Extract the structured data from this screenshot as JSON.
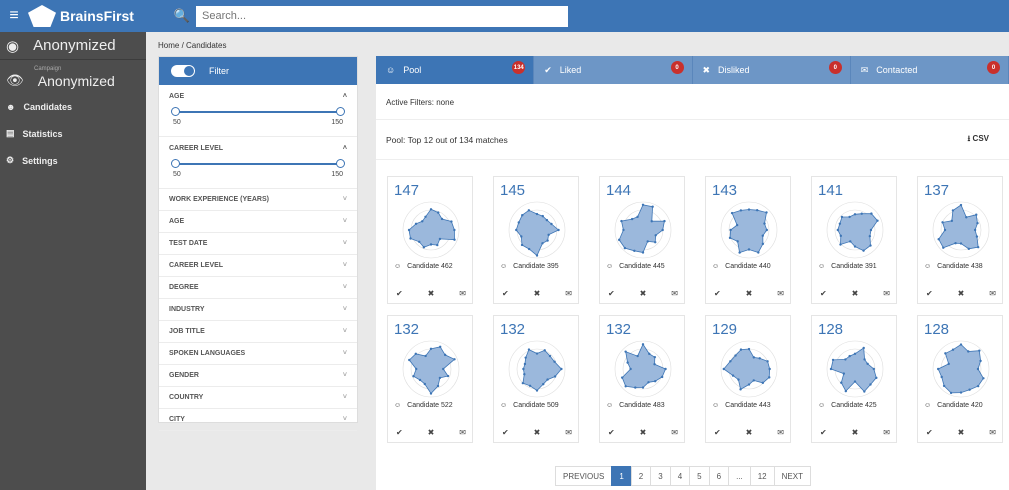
{
  "brand": "BrainsFirst",
  "search": {
    "placeholder": "Search..."
  },
  "sidebar": {
    "user": "Anonymized",
    "campaign_label": "Campaign",
    "campaign": "Anonymized",
    "items": [
      {
        "label": "Candidates",
        "icon": "users-icon"
      },
      {
        "label": "Statistics",
        "icon": "chart-icon"
      },
      {
        "label": "Settings",
        "icon": "gear-icon"
      }
    ]
  },
  "breadcrumb": "Home / Candidates",
  "filter": {
    "title": "Filter",
    "age": {
      "label": "AGE",
      "min": "50",
      "max": "150"
    },
    "career": {
      "label": "CAREER LEVEL",
      "min": "50",
      "max": "150"
    },
    "sections": [
      "WORK EXPERIENCE (YEARS)",
      "AGE",
      "TEST DATE",
      "CAREER LEVEL",
      "DEGREE",
      "INDUSTRY",
      "JOB TITLE",
      "SPOKEN LANGUAGES",
      "GENDER",
      "COUNTRY",
      "CITY"
    ]
  },
  "tabs": [
    {
      "label": "Pool",
      "icon": "person-icon",
      "count": "134"
    },
    {
      "label": "Liked",
      "icon": "check-icon",
      "count": "0"
    },
    {
      "label": "Disliked",
      "icon": "close-icon",
      "count": "0"
    },
    {
      "label": "Contacted",
      "icon": "envelope-icon",
      "count": "0"
    }
  ],
  "active_filters": "Active Filters:  none",
  "pool_title": "Pool: Top 12 out of 134 matches",
  "csv": "CSV",
  "cards": [
    {
      "score": "147",
      "name": "Candidate 462"
    },
    {
      "score": "145",
      "name": "Candidate 395"
    },
    {
      "score": "144",
      "name": "Candidate 445"
    },
    {
      "score": "143",
      "name": "Candidate 440"
    },
    {
      "score": "141",
      "name": "Candidate 391"
    },
    {
      "score": "137",
      "name": "Candidate 438"
    },
    {
      "score": "132",
      "name": "Candidate 522"
    },
    {
      "score": "132",
      "name": "Candidate 509"
    },
    {
      "score": "132",
      "name": "Candidate 483"
    },
    {
      "score": "129",
      "name": "Candidate 443"
    },
    {
      "score": "128",
      "name": "Candidate 425"
    },
    {
      "score": "128",
      "name": "Candidate 420"
    }
  ],
  "pager": {
    "prev": "PREVIOUS",
    "pages": [
      "1",
      "2",
      "3",
      "4",
      "5",
      "6",
      "...",
      "12"
    ],
    "next": "NEXT",
    "current": "1"
  },
  "colors": {
    "accent": "#3d75b5",
    "badge": "#c9302c"
  }
}
